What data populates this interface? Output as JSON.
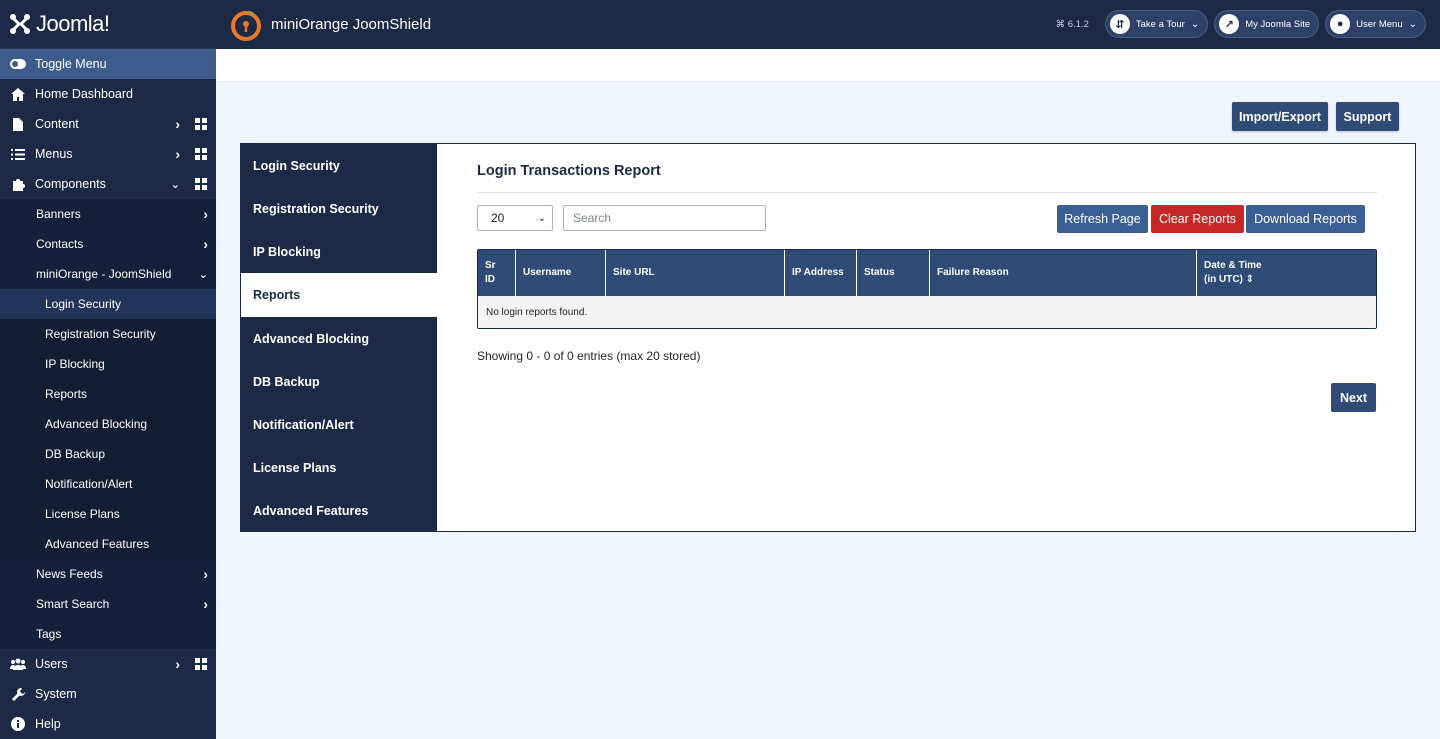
{
  "brand": {
    "name": "Joomla!"
  },
  "header": {
    "title": "miniOrange JoomShield",
    "version": "6.1.2",
    "take_tour": "Take a Tour",
    "my_site": "My Joomla Site",
    "user_menu": "User Menu"
  },
  "sidebar": {
    "toggle": "Toggle Menu",
    "home": "Home Dashboard",
    "content": "Content",
    "menus": "Menus",
    "components": "Components",
    "components_sub": {
      "banners": "Banners",
      "contacts": "Contacts",
      "joomshield": "miniOrange - JoomShield",
      "joomshield_items": [
        "Login Security",
        "Registration Security",
        "IP Blocking",
        "Reports",
        "Advanced Blocking",
        "DB Backup",
        "Notification/Alert",
        "License Plans",
        "Advanced Features"
      ],
      "news_feeds": "News Feeds",
      "smart_search": "Smart Search",
      "tags": "Tags"
    },
    "users": "Users",
    "system": "System",
    "help": "Help"
  },
  "toolbar": {
    "import_export": "Import/Export",
    "support": "Support"
  },
  "tabs": [
    "Login Security",
    "Registration Security",
    "IP Blocking",
    "Reports",
    "Advanced Blocking",
    "DB Backup",
    "Notification/Alert",
    "License Plans",
    "Advanced Features"
  ],
  "report": {
    "title": "Login Transactions Report",
    "page_size": "20",
    "search_placeholder": "Search",
    "refresh": "Refresh Page",
    "clear": "Clear Reports",
    "download": "Download Reports",
    "columns": {
      "sr1": "Sr",
      "sr2": "ID",
      "username": "Username",
      "site_url": "Site URL",
      "ip": "IP Address",
      "status": "Status",
      "failure": "Failure Reason",
      "dt1": "Date & Time",
      "dt2": "(in UTC) ⇕"
    },
    "empty": "No login reports found.",
    "showing": "Showing 0 - 0 of 0 entries (max 20 stored)",
    "next": "Next"
  },
  "colors": {
    "navy": "#1c2a45",
    "button_blue": "#2f4b76",
    "danger": "#c52827"
  }
}
